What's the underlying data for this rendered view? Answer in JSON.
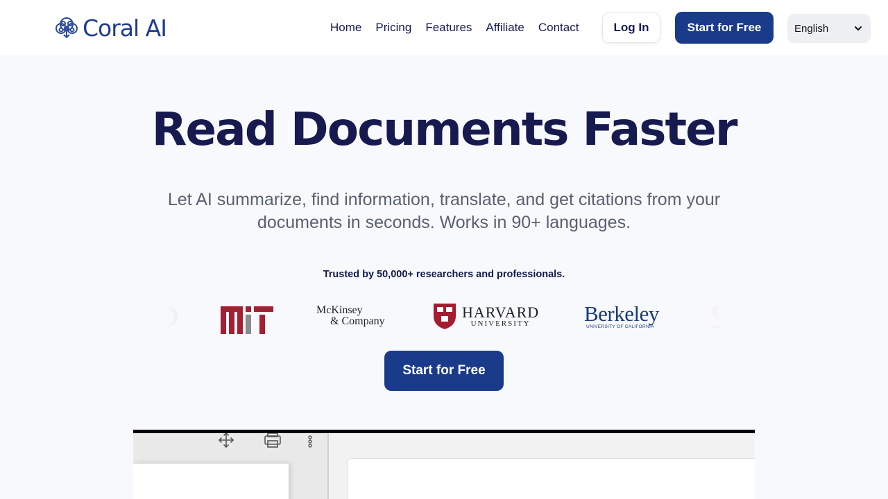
{
  "brand": {
    "name": "Coral AI"
  },
  "nav": {
    "items": [
      "Home",
      "Pricing",
      "Features",
      "Affiliate",
      "Contact"
    ],
    "login_label": "Log In",
    "start_label": "Start for Free",
    "language": "English"
  },
  "hero": {
    "title": "Read Documents Faster",
    "subtitle": "Let AI summarize, find information, translate, and get citations from your documents in seconds. Works in 90+ languages.",
    "trusted_text": "Trusted by 50,000+ researchers and professionals.",
    "cta_label": "Start for Free"
  },
  "logos": {
    "items": [
      "MIT",
      "McKinsey & Company",
      "HARVARD UNIVERSITY",
      "Berkeley UNIVERSITY OF CALIFORNIA"
    ],
    "mckinsey_line1": "McKinsey",
    "mckinsey_line2": "& Company",
    "harvard_line1": "HARVARD",
    "harvard_line2": "UNIVERSITY",
    "berkeley_line1": "Berkeley",
    "berkeley_line2": "UNIVERSITY OF CALIFORNIA"
  },
  "colors": {
    "brand_navy": "#1a3a8a",
    "title_navy": "#171a4e",
    "mit_red": "#a31f34",
    "harvard_red": "#a51c30",
    "berkeley_blue": "#1b3a7a"
  },
  "icons": {
    "brand": "coral-tree-icon",
    "language_dropdown": "chevron-down-icon",
    "toolbar": [
      "move-icon",
      "print-icon",
      "more-vertical-icon"
    ]
  }
}
